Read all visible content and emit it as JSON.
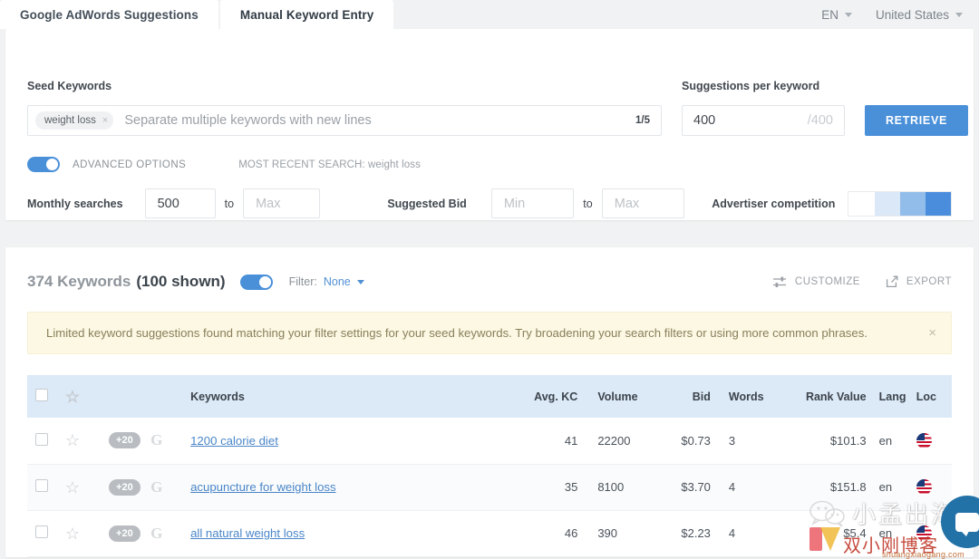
{
  "tabs": [
    {
      "label": "Google AdWords Suggestions",
      "active": true
    },
    {
      "label": "Manual Keyword Entry",
      "active": false
    }
  ],
  "topbar": {
    "language": "EN",
    "country": "United States"
  },
  "search_panel": {
    "seed_label": "Seed Keywords",
    "seed_chips": [
      "weight loss"
    ],
    "seed_placeholder": "Separate multiple keywords with new lines",
    "seed_count": "1/5",
    "suggestions_label": "Suggestions per keyword",
    "suggestions_value": "400",
    "suggestions_max": "/400",
    "retrieve_label": "RETRIEVE",
    "advanced_label": "ADVANCED OPTIONS",
    "advanced_on": true,
    "most_recent": "MOST RECENT SEARCH: weight loss",
    "monthly_label": "Monthly searches",
    "monthly_min": "500",
    "monthly_max_placeholder": "Max",
    "to_label": "to",
    "bid_label": "Suggested Bid",
    "bid_min_placeholder": "Min",
    "bid_max_placeholder": "Max",
    "competition_label": "Advertiser competition",
    "competition_segments": [
      "#ffffff",
      "#dbe8f8",
      "#92bdeb",
      "#4a8ddd"
    ]
  },
  "results": {
    "count_text": "374 Keywords",
    "shown_text": "(100 shown)",
    "toggle_on": true,
    "filter_label": "Filter:",
    "filter_value": "None",
    "customize_label": "CUSTOMIZE",
    "export_label": "EXPORT",
    "alert_text": "Limited keyword suggestions found matching your filter settings for your seed keywords. Try broadening your search filters or using more common phrases.",
    "alert_close": "×",
    "columns": {
      "keywords": "Keywords",
      "avg_kc": "Avg. KC",
      "volume": "Volume",
      "bid": "Bid",
      "words": "Words",
      "rank_value": "Rank Value",
      "lang": "Lang",
      "loc": "Loc"
    },
    "rows": [
      {
        "badge": "+20",
        "keyword": "1200 calorie diet",
        "avg_kc": "41",
        "volume": "22200",
        "bid": "$0.73",
        "words": "3",
        "rank_value": "$101.3",
        "lang": "en",
        "loc": "us"
      },
      {
        "badge": "+20",
        "keyword": "acupuncture for weight loss",
        "avg_kc": "35",
        "volume": "8100",
        "bid": "$3.70",
        "words": "4",
        "rank_value": "$151.8",
        "lang": "en",
        "loc": "us"
      },
      {
        "badge": "+20",
        "keyword": "all natural weight loss",
        "avg_kc": "46",
        "volume": "390",
        "bid": "$2.23",
        "words": "4",
        "rank_value": "$5.4",
        "lang": "en",
        "loc": "us"
      }
    ]
  },
  "watermark": {
    "text_cn": "小孟出海",
    "blog_cn": "双小刚博客",
    "url": "shuangxiaogang.com"
  },
  "colors": {
    "accent": "#4a90d9",
    "link": "#4a86c8",
    "table_header_bg": "#dce9f7",
    "alert_bg": "#fcf8e3"
  }
}
